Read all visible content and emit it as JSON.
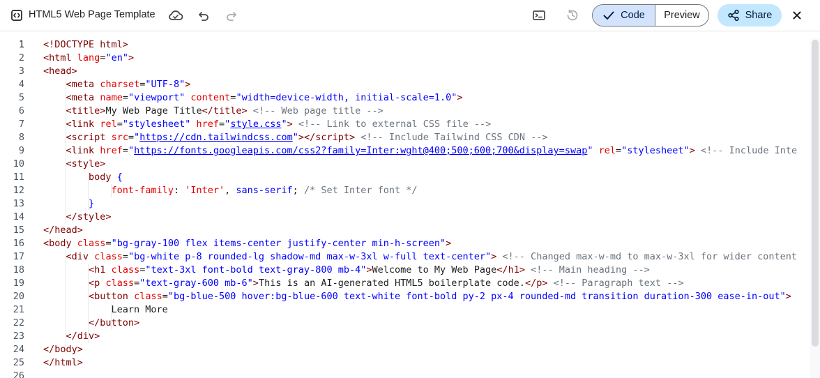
{
  "toolbar": {
    "title": "HTML5 Web Page Template",
    "code_label": "Code",
    "preview_label": "Preview",
    "share_label": "Share",
    "icons": [
      "code-doc-icon",
      "cloud-sync-icon",
      "undo-icon",
      "redo-icon",
      "terminal-icon",
      "history-icon",
      "check-icon",
      "share-icon",
      "close-icon"
    ]
  },
  "editor": {
    "lines": [
      {
        "n": "1",
        "tokens": [
          [
            "p",
            "<!DOCTYPE "
          ],
          [
            "t",
            "html"
          ],
          [
            "p",
            ">"
          ]
        ]
      },
      {
        "n": "2",
        "tokens": [
          [
            "p",
            "<"
          ],
          [
            "t",
            "html"
          ],
          [
            "tx",
            " "
          ],
          [
            "a",
            "lang"
          ],
          [
            "tx",
            "="
          ],
          [
            "v",
            "\"en\""
          ],
          [
            "p",
            ">"
          ]
        ]
      },
      {
        "n": "3",
        "tokens": [
          [
            "p",
            "<"
          ],
          [
            "t",
            "head"
          ],
          [
            "p",
            ">"
          ]
        ]
      },
      {
        "n": "4",
        "tokens": [
          [
            "tx",
            "    "
          ],
          [
            "p",
            "<"
          ],
          [
            "t",
            "meta"
          ],
          [
            "tx",
            " "
          ],
          [
            "a",
            "charset"
          ],
          [
            "tx",
            "="
          ],
          [
            "v",
            "\"UTF-8\""
          ],
          [
            "p",
            ">"
          ]
        ]
      },
      {
        "n": "5",
        "tokens": [
          [
            "tx",
            "    "
          ],
          [
            "p",
            "<"
          ],
          [
            "t",
            "meta"
          ],
          [
            "tx",
            " "
          ],
          [
            "a",
            "name"
          ],
          [
            "tx",
            "="
          ],
          [
            "v",
            "\"viewport\""
          ],
          [
            "tx",
            " "
          ],
          [
            "a",
            "content"
          ],
          [
            "tx",
            "="
          ],
          [
            "v",
            "\"width=device-width, initial-scale=1.0\""
          ],
          [
            "p",
            ">"
          ]
        ]
      },
      {
        "n": "6",
        "tokens": [
          [
            "tx",
            "    "
          ],
          [
            "p",
            "<"
          ],
          [
            "t",
            "title"
          ],
          [
            "p",
            ">"
          ],
          [
            "tx",
            "My Web Page Title"
          ],
          [
            "p",
            "</"
          ],
          [
            "t",
            "title"
          ],
          [
            "p",
            ">"
          ],
          [
            "tx",
            " "
          ],
          [
            "cm",
            "<!-- Web page title -->"
          ]
        ]
      },
      {
        "n": "7",
        "tokens": [
          [
            "tx",
            "    "
          ],
          [
            "p",
            "<"
          ],
          [
            "t",
            "link"
          ],
          [
            "tx",
            " "
          ],
          [
            "a",
            "rel"
          ],
          [
            "tx",
            "="
          ],
          [
            "v",
            "\"stylesheet\""
          ],
          [
            "tx",
            " "
          ],
          [
            "a",
            "href"
          ],
          [
            "tx",
            "="
          ],
          [
            "v",
            "\""
          ],
          [
            "u",
            "style.css"
          ],
          [
            "v",
            "\""
          ],
          [
            "p",
            ">"
          ],
          [
            "tx",
            " "
          ],
          [
            "cm",
            "<!-- Link to external CSS file -->"
          ]
        ]
      },
      {
        "n": "8",
        "tokens": [
          [
            "tx",
            "    "
          ],
          [
            "p",
            "<"
          ],
          [
            "t",
            "script"
          ],
          [
            "tx",
            " "
          ],
          [
            "a",
            "src"
          ],
          [
            "tx",
            "="
          ],
          [
            "v",
            "\""
          ],
          [
            "u",
            "https://cdn.tailwindcss.com"
          ],
          [
            "v",
            "\""
          ],
          [
            "p",
            "></"
          ],
          [
            "t",
            "script"
          ],
          [
            "p",
            ">"
          ],
          [
            "tx",
            " "
          ],
          [
            "cm",
            "<!-- Include Tailwind CSS CDN -->"
          ]
        ]
      },
      {
        "n": "9",
        "tokens": [
          [
            "tx",
            "    "
          ],
          [
            "p",
            "<"
          ],
          [
            "t",
            "link"
          ],
          [
            "tx",
            " "
          ],
          [
            "a",
            "href"
          ],
          [
            "tx",
            "="
          ],
          [
            "v",
            "\""
          ],
          [
            "u",
            "https://fonts.googleapis.com/css2?family=Inter:wght@400;500;600;700&display=swap"
          ],
          [
            "v",
            "\""
          ],
          [
            "tx",
            " "
          ],
          [
            "a",
            "rel"
          ],
          [
            "tx",
            "="
          ],
          [
            "v",
            "\"stylesheet\""
          ],
          [
            "p",
            ">"
          ],
          [
            "tx",
            " "
          ],
          [
            "cm",
            "<!-- Include Inte"
          ]
        ]
      },
      {
        "n": "10",
        "tokens": [
          [
            "tx",
            "    "
          ],
          [
            "p",
            "<"
          ],
          [
            "t",
            "style"
          ],
          [
            "p",
            ">"
          ]
        ]
      },
      {
        "n": "11",
        "tokens": [
          [
            "tx",
            "        "
          ],
          [
            "t",
            "body"
          ],
          [
            "tx",
            " "
          ],
          [
            "v",
            "{"
          ]
        ]
      },
      {
        "n": "12",
        "tokens": [
          [
            "tx",
            "            "
          ],
          [
            "a",
            "font-family"
          ],
          [
            "tx",
            ": "
          ],
          [
            "a",
            "'Inter'"
          ],
          [
            "tx",
            ", "
          ],
          [
            "v",
            "sans-serif"
          ],
          [
            "tx",
            "; "
          ],
          [
            "cm",
            "/* Set Inter font */"
          ]
        ]
      },
      {
        "n": "13",
        "tokens": [
          [
            "tx",
            "        "
          ],
          [
            "v",
            "}"
          ]
        ]
      },
      {
        "n": "14",
        "tokens": [
          [
            "tx",
            "    "
          ],
          [
            "p",
            "</"
          ],
          [
            "t",
            "style"
          ],
          [
            "p",
            ">"
          ]
        ]
      },
      {
        "n": "15",
        "tokens": [
          [
            "p",
            "</"
          ],
          [
            "t",
            "head"
          ],
          [
            "p",
            ">"
          ]
        ]
      },
      {
        "n": "16",
        "tokens": [
          [
            "p",
            "<"
          ],
          [
            "t",
            "body"
          ],
          [
            "tx",
            " "
          ],
          [
            "a",
            "class"
          ],
          [
            "tx",
            "="
          ],
          [
            "v",
            "\"bg-gray-100 flex items-center justify-center min-h-screen\""
          ],
          [
            "p",
            ">"
          ]
        ]
      },
      {
        "n": "17",
        "tokens": [
          [
            "tx",
            "    "
          ],
          [
            "p",
            "<"
          ],
          [
            "t",
            "div"
          ],
          [
            "tx",
            " "
          ],
          [
            "a",
            "class"
          ],
          [
            "tx",
            "="
          ],
          [
            "v",
            "\"bg-white p-8 rounded-lg shadow-md max-w-3xl w-full text-center\""
          ],
          [
            "p",
            ">"
          ],
          [
            "tx",
            " "
          ],
          [
            "cm",
            "<!-- Changed max-w-md to max-w-3xl for wider content"
          ]
        ]
      },
      {
        "n": "18",
        "tokens": [
          [
            "tx",
            "        "
          ],
          [
            "p",
            "<"
          ],
          [
            "t",
            "h1"
          ],
          [
            "tx",
            " "
          ],
          [
            "a",
            "class"
          ],
          [
            "tx",
            "="
          ],
          [
            "v",
            "\"text-3xl font-bold text-gray-800 mb-4\""
          ],
          [
            "p",
            ">"
          ],
          [
            "tx",
            "Welcome to My Web Page"
          ],
          [
            "p",
            "</"
          ],
          [
            "t",
            "h1"
          ],
          [
            "p",
            ">"
          ],
          [
            "tx",
            " "
          ],
          [
            "cm",
            "<!-- Main heading -->"
          ]
        ]
      },
      {
        "n": "19",
        "tokens": [
          [
            "tx",
            "        "
          ],
          [
            "p",
            "<"
          ],
          [
            "t",
            "p"
          ],
          [
            "tx",
            " "
          ],
          [
            "a",
            "class"
          ],
          [
            "tx",
            "="
          ],
          [
            "v",
            "\"text-gray-600 mb-6\""
          ],
          [
            "p",
            ">"
          ],
          [
            "tx",
            "This is an AI-generated HTML5 boilerplate code."
          ],
          [
            "p",
            "</"
          ],
          [
            "t",
            "p"
          ],
          [
            "p",
            ">"
          ],
          [
            "tx",
            " "
          ],
          [
            "cm",
            "<!-- Paragraph text -->"
          ]
        ]
      },
      {
        "n": "20",
        "tokens": [
          [
            "tx",
            "        "
          ],
          [
            "p",
            "<"
          ],
          [
            "t",
            "button"
          ],
          [
            "tx",
            " "
          ],
          [
            "a",
            "class"
          ],
          [
            "tx",
            "="
          ],
          [
            "v",
            "\"bg-blue-500 hover:bg-blue-600 text-white font-bold py-2 px-4 rounded-md transition duration-300 ease-in-out\""
          ],
          [
            "p",
            ">"
          ]
        ]
      },
      {
        "n": "21",
        "tokens": [
          [
            "tx",
            "            Learn More"
          ]
        ]
      },
      {
        "n": "22",
        "tokens": [
          [
            "tx",
            "        "
          ],
          [
            "p",
            "</"
          ],
          [
            "t",
            "button"
          ],
          [
            "p",
            ">"
          ]
        ]
      },
      {
        "n": "23",
        "tokens": [
          [
            "tx",
            "    "
          ],
          [
            "p",
            "</"
          ],
          [
            "t",
            "div"
          ],
          [
            "p",
            ">"
          ]
        ]
      },
      {
        "n": "24",
        "tokens": [
          [
            "p",
            "</"
          ],
          [
            "t",
            "body"
          ],
          [
            "p",
            ">"
          ]
        ]
      },
      {
        "n": "25",
        "tokens": [
          [
            "p",
            "</"
          ],
          [
            "t",
            "html"
          ],
          [
            "p",
            ">"
          ]
        ]
      },
      {
        "n": "26",
        "tokens": []
      }
    ]
  }
}
